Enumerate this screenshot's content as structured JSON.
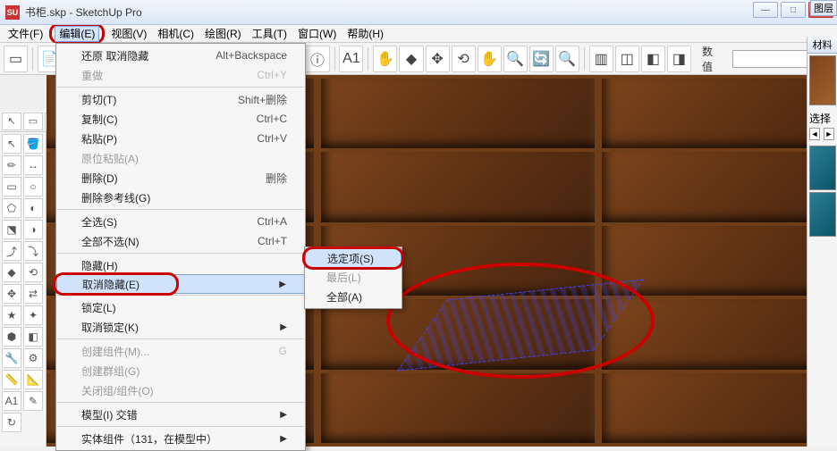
{
  "window": {
    "title": "书柜.skp - SketchUp Pro",
    "app_icon": "SU"
  },
  "win_controls": {
    "min": "—",
    "max": "□",
    "close": "×"
  },
  "menubar": [
    {
      "label": "文件(F)",
      "name": "menu-file"
    },
    {
      "label": "编辑(E)",
      "name": "menu-edit",
      "active": true,
      "highlight": true
    },
    {
      "label": "视图(V)",
      "name": "menu-view"
    },
    {
      "label": "相机(C)",
      "name": "menu-camera"
    },
    {
      "label": "绘图(R)",
      "name": "menu-draw"
    },
    {
      "label": "工具(T)",
      "name": "menu-tools"
    },
    {
      "label": "窗口(W)",
      "name": "menu-window"
    },
    {
      "label": "帮助(H)",
      "name": "menu-help"
    }
  ],
  "edit_menu": {
    "groups": [
      [
        {
          "label": "还原 取消隐藏",
          "short": "Alt+Backspace",
          "name": "undo"
        },
        {
          "label": "重做",
          "short": "Ctrl+Y",
          "disabled": true,
          "name": "redo"
        }
      ],
      [
        {
          "label": "剪切(T)",
          "short": "Shift+删除",
          "name": "cut"
        },
        {
          "label": "复制(C)",
          "short": "Ctrl+C",
          "name": "copy"
        },
        {
          "label": "粘贴(P)",
          "short": "Ctrl+V",
          "name": "paste"
        },
        {
          "label": "原位粘贴(A)",
          "disabled": true,
          "name": "paste-in-place"
        },
        {
          "label": "删除(D)",
          "short": "删除",
          "name": "delete"
        },
        {
          "label": "删除参考线(G)",
          "name": "delete-guides"
        }
      ],
      [
        {
          "label": "全选(S)",
          "short": "Ctrl+A",
          "name": "select-all"
        },
        {
          "label": "全部不选(N)",
          "short": "Ctrl+T",
          "name": "select-none"
        }
      ],
      [
        {
          "label": "隐藏(H)",
          "name": "hide"
        },
        {
          "label": "取消隐藏(E)",
          "submenu": true,
          "highlight": true,
          "name": "unhide"
        }
      ],
      [
        {
          "label": "锁定(L)",
          "name": "lock"
        },
        {
          "label": "取消锁定(K)",
          "submenu": true,
          "name": "unlock"
        }
      ],
      [
        {
          "label": "创建组件(M)...",
          "short": "G",
          "disabled": true,
          "name": "make-component"
        },
        {
          "label": "创建群组(G)",
          "disabled": true,
          "name": "make-group"
        },
        {
          "label": "关闭组/组件(O)",
          "disabled": true,
          "name": "close-group"
        }
      ],
      [
        {
          "label": "模型(I) 交错",
          "submenu": true,
          "name": "intersect"
        }
      ],
      [
        {
          "label": "实体组件（131，在模型中）",
          "submenu": true,
          "name": "entity-component"
        }
      ]
    ]
  },
  "unhide_submenu": [
    {
      "label": "选定项(S)",
      "highlight": true,
      "hover": true,
      "name": "unhide-selected"
    },
    {
      "label": "最后(L)",
      "disabled": true,
      "name": "unhide-last"
    },
    {
      "label": "全部(A)",
      "name": "unhide-all"
    }
  ],
  "toolbar_large": {
    "value_label": "数值"
  },
  "right_panels": {
    "layers": "图层",
    "materials": "材料",
    "select": "选择"
  }
}
